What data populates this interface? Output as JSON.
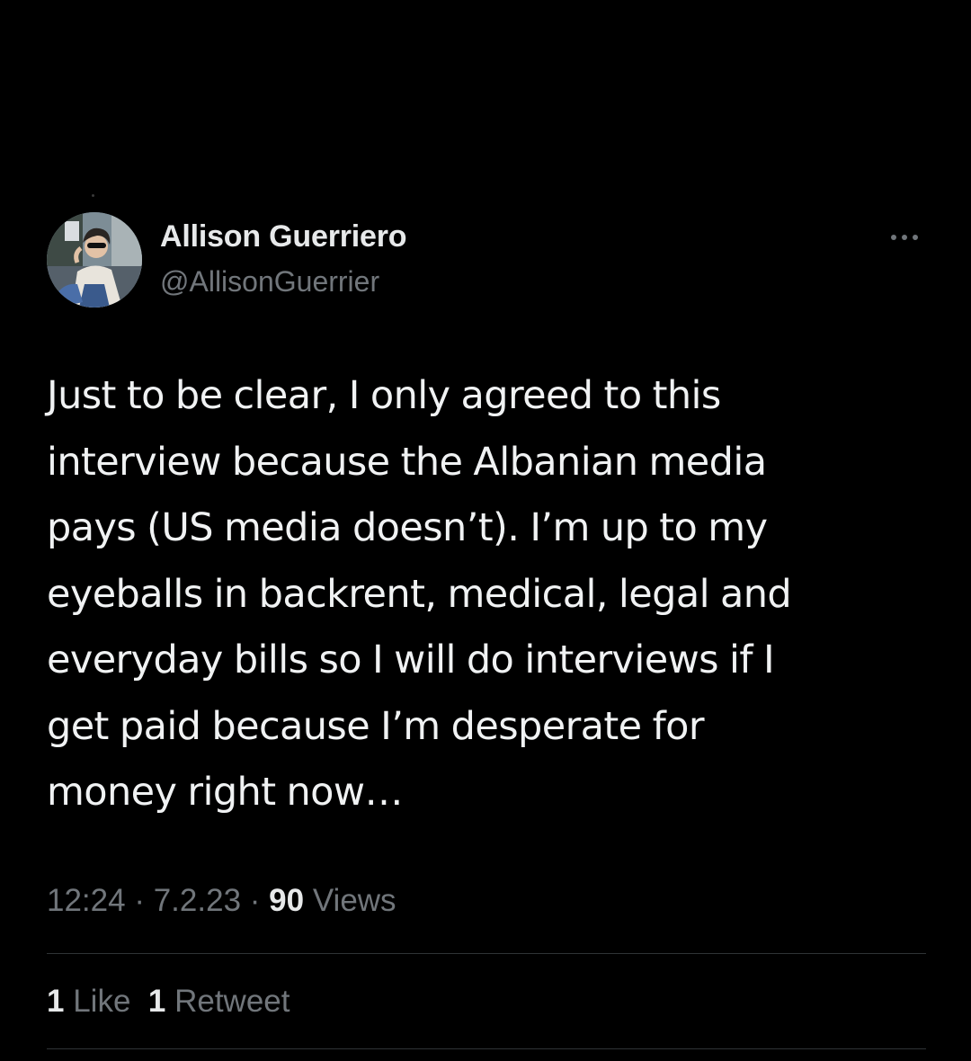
{
  "tweet": {
    "author": {
      "name": "Allison Guerriero",
      "handle": "@AllisonGuerrier"
    },
    "text": "Just to be clear, I only agreed to this\ninterview because the Albanian media\npays (US media doesn’t). I’m up to my\neyeballs in backrent, medical, legal and\neveryday bills so I will do interviews if I\nget paid because I’m desperate for\nmoney right now…",
    "time": "12:24",
    "date": "7.2.23",
    "separator": "·",
    "views_count": "90",
    "views_label": "Views",
    "likes_count": "1",
    "likes_label": "Like",
    "retweets_count": "1",
    "retweets_label": "Retweet"
  },
  "icons": {
    "more": "more-horizontal-icon",
    "avatar": "profile-photo"
  },
  "colors": {
    "background": "#000000",
    "primary_text": "#e7e9ea",
    "secondary_text": "#71767b",
    "divider": "#2f3336"
  }
}
